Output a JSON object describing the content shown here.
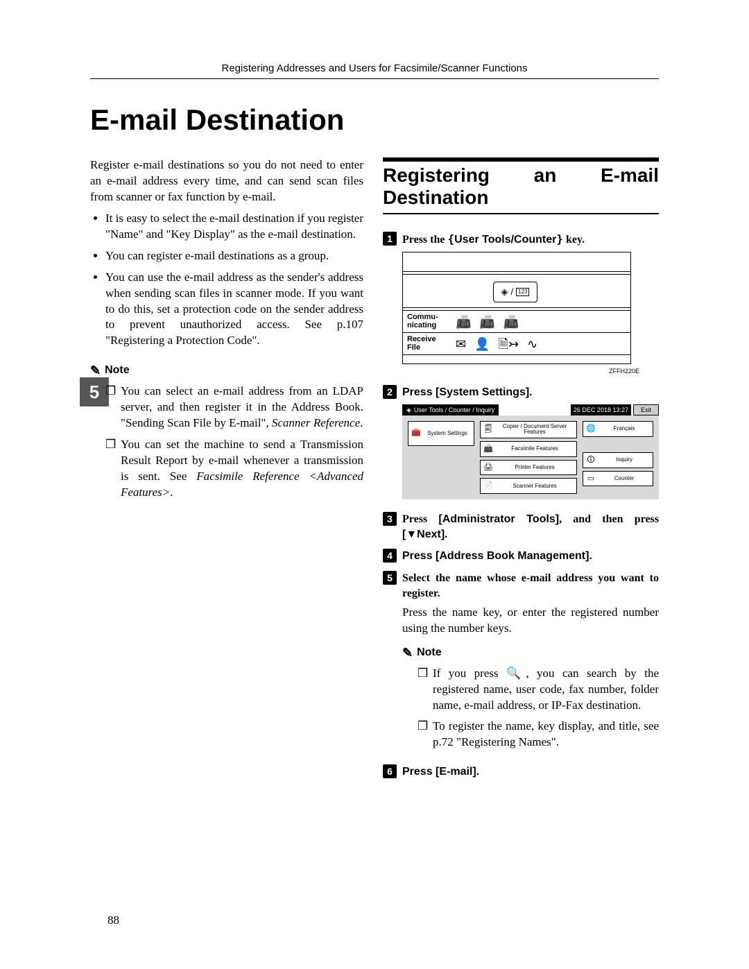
{
  "running_head": "Registering Addresses and Users for Facsimile/Scanner Functions",
  "main_title": "E-mail Destination",
  "side_tab": "5",
  "page_number": "88",
  "left": {
    "intro": "Register e-mail destinations so you do not need to enter an e-mail address every time, and can send scan files from scanner or fax function by e-mail.",
    "bullets": [
      "It is easy to select the e-mail destination if you register \"Name\" and \"Key Display\" as the e-mail destination.",
      "You can register e-mail destinations as a group.",
      "You can use the e-mail address as the sender's address when sending scan files in scanner mode. If you want to do this, set a protection code on the sender address to prevent unauthorized access. See p.107 \"Registering a Protection Code\"."
    ],
    "note_label": "Note",
    "notes": [
      {
        "pre": "You can select an e-mail address from an LDAP server, and then register it in the Address Book. \"Sending Scan File by E-mail\", ",
        "ital": "Scanner Reference",
        "post": "."
      },
      {
        "pre": "You can set the machine to send a Transmission Result Report by e-mail whenever a transmission is sent. See ",
        "ital": "Facsimile Reference <Advanced Features>",
        "post": "."
      }
    ]
  },
  "right": {
    "subheading": "Registering an E-mail Destination",
    "step1_pre": "Press the ",
    "step1_key": "User Tools/Counter",
    "step1_post": " key.",
    "fig1": {
      "row_commu": "Commu- nicating",
      "row_recv": "Receive File",
      "key_tag": "123",
      "code": "ZFFH220E"
    },
    "step2": "Press [System Settings].",
    "fig2": {
      "breadcrumb": "User Tools / Counter / Inquiry",
      "date": "26 DEC   2018 13:27",
      "exit": "Exit",
      "left_btn": "System Settings",
      "mid": [
        "Copier / Document Server Features",
        "Facsimile Features",
        "Printer Features",
        "Scanner Features"
      ],
      "right": [
        "Français",
        "Inquiry",
        "Counter"
      ]
    },
    "step3_pre": "Press ",
    "step3_b1": "[Administrator Tools]",
    "step3_mid": ", and then press ",
    "step3_b2": "[▼Next]",
    "step3_post": ".",
    "step4": "Press [Address Book Management].",
    "step5": "Select the name whose e-mail address you want to register.",
    "step5_body": "Press the name key, or enter the registered number using the number keys.",
    "note2_label": "Note",
    "notes2": [
      "If you press 🔍, you can search by the registered name, user code, fax number, folder name, e-mail address, or IP-Fax destination.",
      "To register the name, key display, and title, see p.72 \"Registering Names\"."
    ],
    "step6": "Press [E-mail]."
  }
}
